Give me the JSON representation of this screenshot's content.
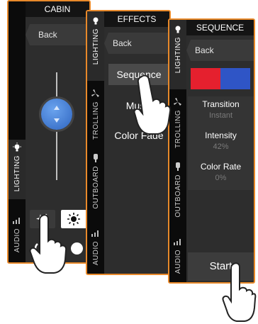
{
  "cabin": {
    "title": "CABIN",
    "back_label": "Back",
    "tabs": [
      {
        "label": "LIGHTING",
        "icon": "bulb-icon"
      },
      {
        "label": "AUDIO",
        "icon": "audio-bars-icon"
      }
    ]
  },
  "effects": {
    "title": "EFFECTS",
    "back_label": "Back",
    "items": [
      "Sequence",
      "Music",
      "Color Fade"
    ],
    "tabs": [
      {
        "label": "LIGHTING",
        "icon": "bulb-icon"
      },
      {
        "label": "TROLLING",
        "icon": "fan-icon"
      },
      {
        "label": "OUTBOARD",
        "icon": "bulb-icon"
      },
      {
        "label": "AUDIO",
        "icon": "audio-bars-icon"
      }
    ]
  },
  "sequence": {
    "title": "SEQUENCE",
    "back_label": "Back",
    "colors": [
      "#e5202e",
      "#2f55c6"
    ],
    "transition_label": "Transition",
    "transition_value": "Instant",
    "intensity_label": "Intensity",
    "intensity_value": "42%",
    "color_rate_label": "Color Rate",
    "color_rate_value": "0%",
    "start_label": "Start",
    "tabs": [
      {
        "label": "LIGHTING",
        "icon": "bulb-icon"
      },
      {
        "label": "TROLLING",
        "icon": "fan-icon"
      },
      {
        "label": "OUTBOARD",
        "icon": "bulb-icon"
      },
      {
        "label": "AUDIO",
        "icon": "audio-bars-icon"
      }
    ]
  },
  "colors": {
    "accent": "#e8892a",
    "panel": "#2d2d2d",
    "knob": "#3f7fd6"
  }
}
